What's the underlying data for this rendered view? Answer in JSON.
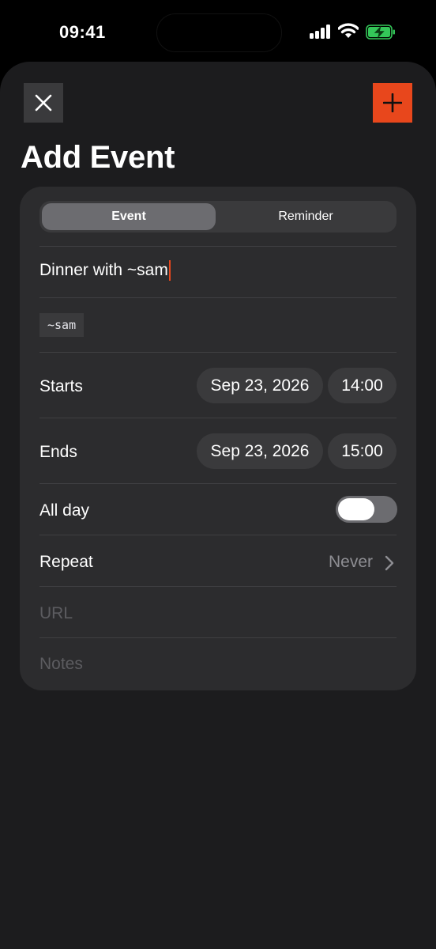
{
  "status_bar": {
    "time": "09:41"
  },
  "header": {
    "title": "Add Event"
  },
  "segmented": {
    "options": [
      "Event",
      "Reminder"
    ],
    "selected": "Event"
  },
  "form": {
    "title_value": "Dinner with ~sam",
    "tag": "~sam",
    "starts": {
      "label": "Starts",
      "date": "Sep 23, 2026",
      "time": "14:00"
    },
    "ends": {
      "label": "Ends",
      "date": "Sep 23, 2026",
      "time": "15:00"
    },
    "all_day": {
      "label": "All day",
      "on": false
    },
    "repeat": {
      "label": "Repeat",
      "value": "Never"
    },
    "url": {
      "placeholder": "URL"
    },
    "notes": {
      "placeholder": "Notes"
    }
  },
  "colors": {
    "accent": "#e8471c",
    "background": "#1c1c1e",
    "card": "#2c2c2e",
    "battery": "#34c759"
  },
  "icons": {
    "close": "close-icon",
    "add": "plus-icon",
    "repeat_chevron": "chevron-right-icon"
  }
}
